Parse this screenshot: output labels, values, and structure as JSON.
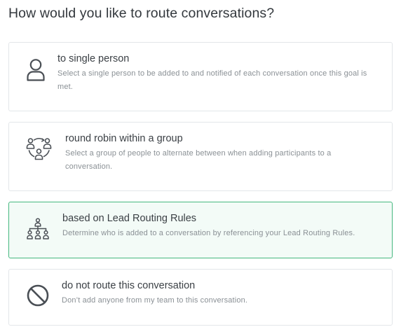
{
  "page": {
    "title": "How would you like to route conversations?"
  },
  "options": [
    {
      "id": "single-person",
      "title": "to single person",
      "description": "Select a single person to be added to and notified of each conversation once this goal is met.",
      "icon": "person-icon",
      "selected": false
    },
    {
      "id": "round-robin",
      "title": "round robin within a group",
      "description": "Select a group of people to alternate between when adding participants to a conversation.",
      "icon": "round-robin-group-icon",
      "selected": false
    },
    {
      "id": "lead-routing",
      "title": "based on Lead Routing Rules",
      "description": "Determine who is added to a conversation by referencing your Lead Routing Rules.",
      "icon": "org-chart-icon",
      "selected": true
    },
    {
      "id": "do-not-route",
      "title": "do not route this conversation",
      "description": "Don’t add anyone from my team to this conversation.",
      "icon": "prohibited-icon",
      "selected": false
    }
  ],
  "colors": {
    "selected_border": "#45b87f",
    "selected_background": "#f3fbf7",
    "card_border": "#e3e6e9",
    "icon": "#4a4f55",
    "title_text": "#3b4045",
    "description_text": "#8a9095"
  }
}
